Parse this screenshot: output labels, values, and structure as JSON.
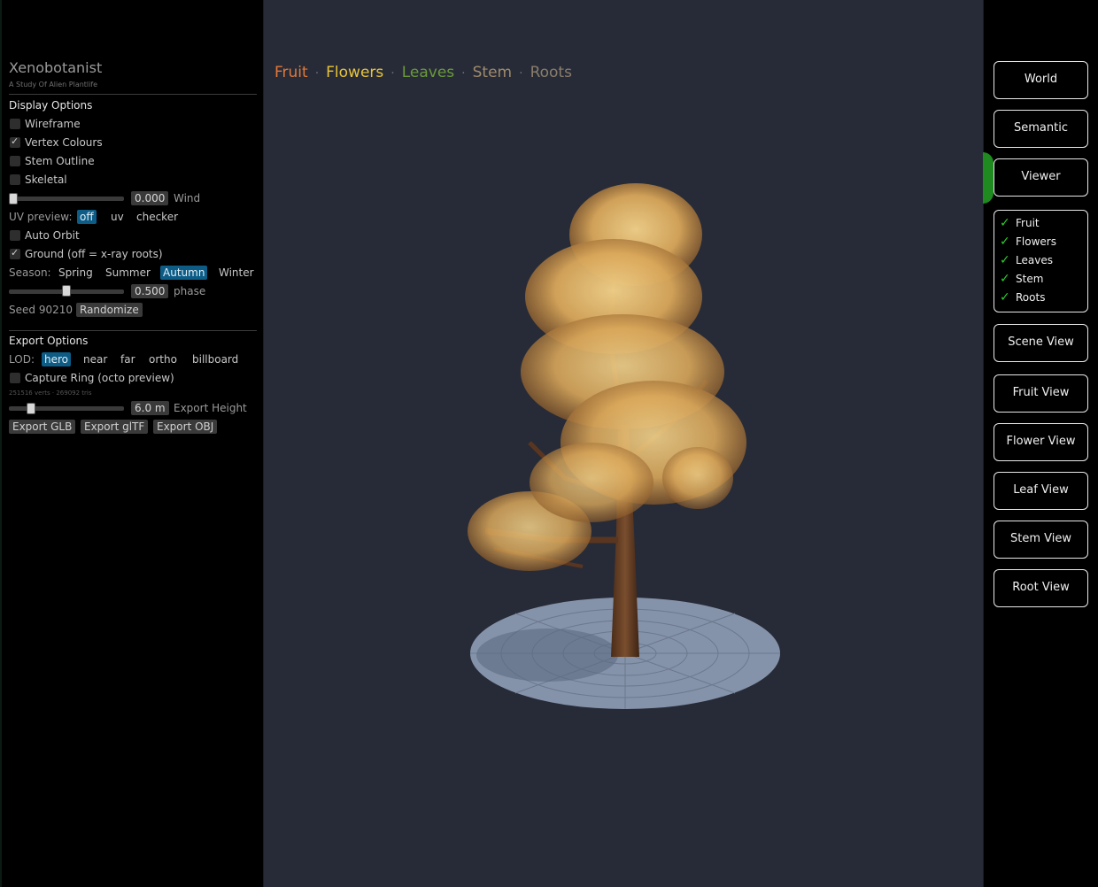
{
  "app": {
    "title": "Xenobotanist",
    "subtitle": "A Study Of Alien Plantlife"
  },
  "display": {
    "heading": "Display Options",
    "wireframe": {
      "label": "Wireframe",
      "checked": false
    },
    "vertex_colours": {
      "label": "Vertex Colours",
      "checked": true
    },
    "stem_outline": {
      "label": "Stem Outline",
      "checked": false
    },
    "skeletal": {
      "label": "Skeletal",
      "checked": false
    },
    "wind": {
      "value": "0.000",
      "label": "Wind",
      "level": 0.0
    },
    "uv_preview": {
      "label": "UV preview:",
      "options": [
        "off",
        "uv",
        "checker"
      ],
      "selected": "off"
    },
    "auto_orbit": {
      "label": "Auto Orbit",
      "checked": false
    },
    "ground": {
      "label": "Ground (off = x-ray roots)",
      "checked": true
    },
    "season": {
      "label": "Season:",
      "options": [
        "Spring",
        "Summer",
        "Autumn",
        "Winter"
      ],
      "selected": "Autumn"
    },
    "phase": {
      "value": "0.500",
      "label": "phase",
      "level": 0.5
    },
    "seed": {
      "label": "Seed 90210",
      "button": "Randomize"
    }
  },
  "export": {
    "heading": "Export Options",
    "lod": {
      "label": "LOD:",
      "options": [
        "hero",
        "near",
        "far",
        "ortho",
        "billboard"
      ],
      "selected": "hero"
    },
    "capture_ring": {
      "label": "Capture Ring (octo preview)",
      "checked": false
    },
    "stats": "251516 verts · 269092 tris",
    "height": {
      "value": "6.0 m",
      "label": "Export Height",
      "level": 0.17
    },
    "buttons": [
      "Export GLB",
      "Export glTF",
      "Export OBJ"
    ]
  },
  "viewport": {
    "layers": [
      {
        "label": "Fruit",
        "color": "#e0783a"
      },
      {
        "label": "Flowers",
        "color": "#e8c43a"
      },
      {
        "label": "Leaves",
        "color": "#6a9a3a"
      },
      {
        "label": "Stem",
        "color": "#a08a6a"
      },
      {
        "label": "Roots",
        "color": "#8a7e6a"
      }
    ],
    "separator": "·"
  },
  "right": {
    "world": "World",
    "semantic": "Semantic",
    "viewer": "Viewer",
    "layer_checks": [
      "Fruit",
      "Flowers",
      "Leaves",
      "Stem",
      "Roots"
    ],
    "scene_view": "Scene View",
    "fruit_view": "Fruit View",
    "flower_view": "Flower View",
    "leaf_view": "Leaf View",
    "stem_view": "Stem View",
    "root_view": "Root View"
  }
}
